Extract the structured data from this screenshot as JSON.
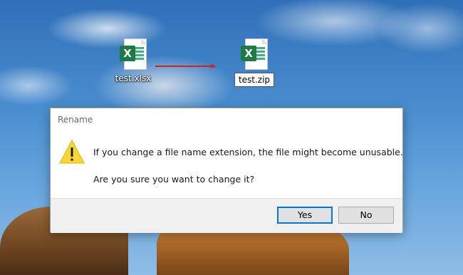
{
  "desktop": {
    "source_file": {
      "label": "test.xlsx",
      "icon": "excel-file-icon",
      "badge": "X"
    },
    "renamed_file": {
      "label": "test.zip",
      "icon": "excel-file-icon",
      "badge": "X"
    },
    "arrow_color": "#d62020"
  },
  "dialog": {
    "title": "Rename",
    "icon": "warning-icon",
    "message_line1": "If you change a file name extension, the file might become unusable.",
    "message_line2": "Are you sure you want to change it?",
    "buttons": {
      "yes_label": "Yes",
      "no_label": "No"
    },
    "accent_color": "#0078d7",
    "warning_color": "#f7d630"
  }
}
